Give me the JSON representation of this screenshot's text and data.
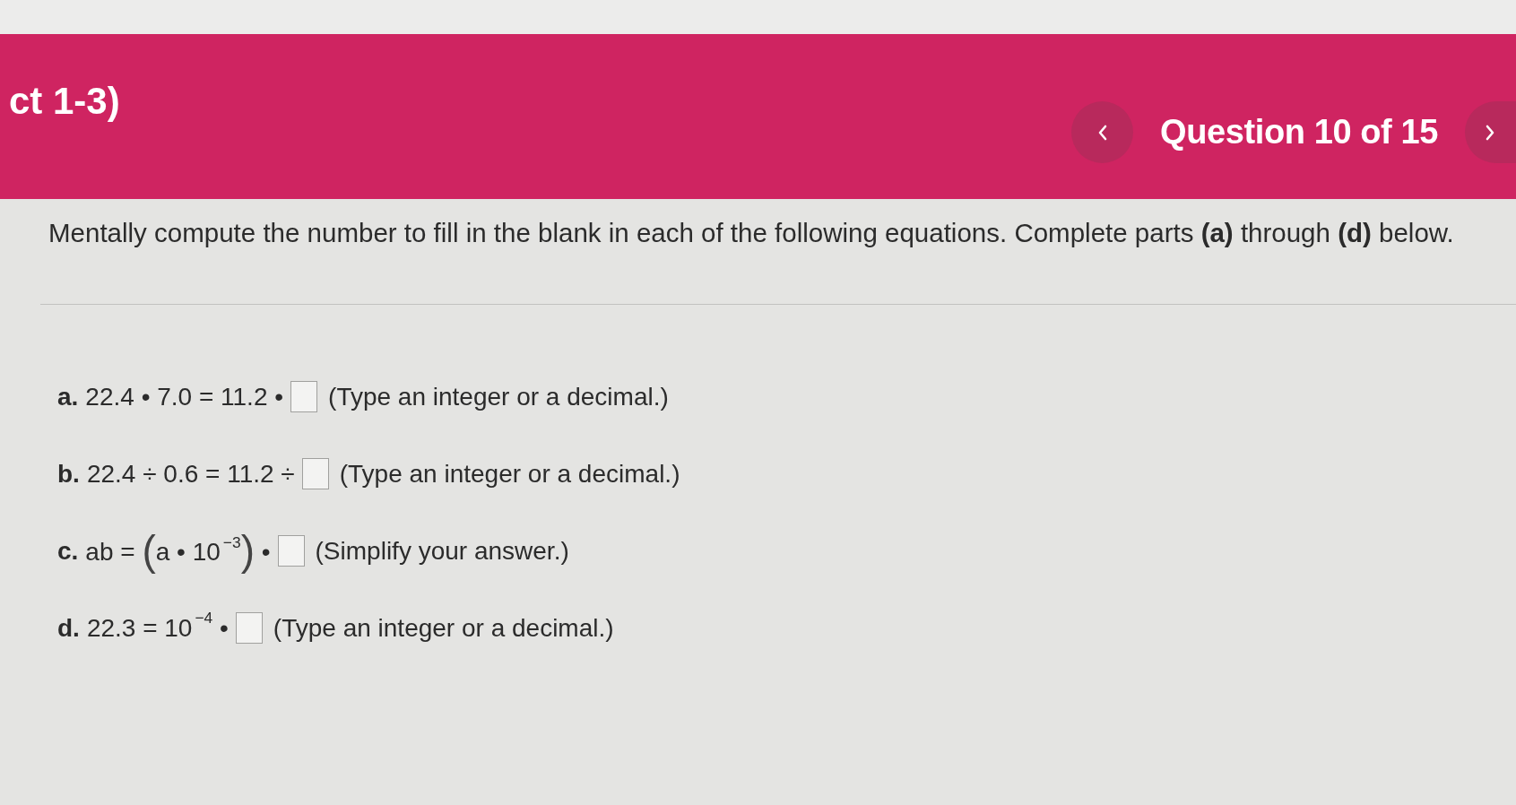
{
  "header": {
    "title": "ct 1-3)",
    "question_counter": "Question 10 of 15"
  },
  "instructions": "Mentally compute the number to fill in the blank in each of the following equations. Complete parts **(a)** through **(d)** below.",
  "parts": [
    {
      "label": "a.",
      "equation": [
        {
          "kind": "text",
          "text": "22.4 • 7.0 = 11.2 •"
        }
      ],
      "hint": "(Type an integer or a decimal.)"
    },
    {
      "label": "b.",
      "equation": [
        {
          "kind": "text",
          "text": "22.4 ÷ 0.6 = 11.2 ÷"
        }
      ],
      "hint": "(Type an integer or a decimal.)"
    },
    {
      "label": "c.",
      "equation": [
        {
          "kind": "text",
          "text": "ab ="
        },
        {
          "kind": "group",
          "open": "(",
          "body": "a • 10$^{−3}$",
          "close": ")"
        },
        {
          "kind": "text",
          "text": "•"
        }
      ],
      "hint": "(Simplify your answer.)"
    },
    {
      "label": "d.",
      "equation": [
        {
          "kind": "text",
          "text": "22.3 = 10$^{−4}$ •"
        }
      ],
      "hint": "(Type an integer or a decimal.)"
    }
  ]
}
